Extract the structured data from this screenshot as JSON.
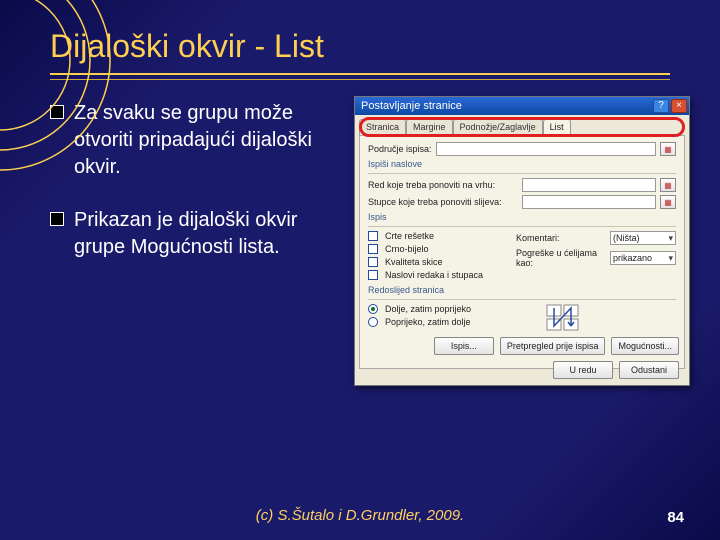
{
  "title": "Dijaloški okvir - List",
  "bullets": [
    "Za svaku se grupu može otvoriti pripadajući dijaloški okvir.",
    "Prikazan je dijaloški okvir grupe Mogućnosti lista."
  ],
  "footer": "(c) S.Šutalo i D.Grundler, 2009.",
  "page": "84",
  "dlg": {
    "title": "Postavljanje stranice",
    "help": "?",
    "close": "×",
    "tabs": [
      "Stranica",
      "Margine",
      "Podnožje/Zaglavlje",
      "List"
    ],
    "activeTab": 3,
    "sections": {
      "podrucje": "Područje ispisa:",
      "ispisNaslova": "Ispiši naslove",
      "redLabel": "Red koje treba ponoviti na vrhu:",
      "stupciLabel": "Stupce koje treba ponoviti slijeva:",
      "ispis": "Ispis",
      "opt1": "Crte rešetke",
      "opt2": "Crno-bijelo",
      "opt3": "Kvaliteta skice",
      "opt4": "Naslovi redaka i stupaca",
      "komentariLbl": "Komentari:",
      "komentariVal": "(Ništa)",
      "pogreskeLbl": "Pogreške u ćelijama kao:",
      "pogreskeVal": "prikazano",
      "redoslijed": "Redoslijed stranica",
      "r1": "Dolje, zatim poprijeko",
      "r2": "Poprijeko, zatim dolje"
    },
    "buttonsRow1": {
      "ispis": "Ispis...",
      "pretpregled": "Pretpregled prije ispisa",
      "mogucnosti": "Mogućnosti..."
    },
    "buttonsRow2": {
      "ok": "U redu",
      "cancel": "Odustani"
    }
  }
}
